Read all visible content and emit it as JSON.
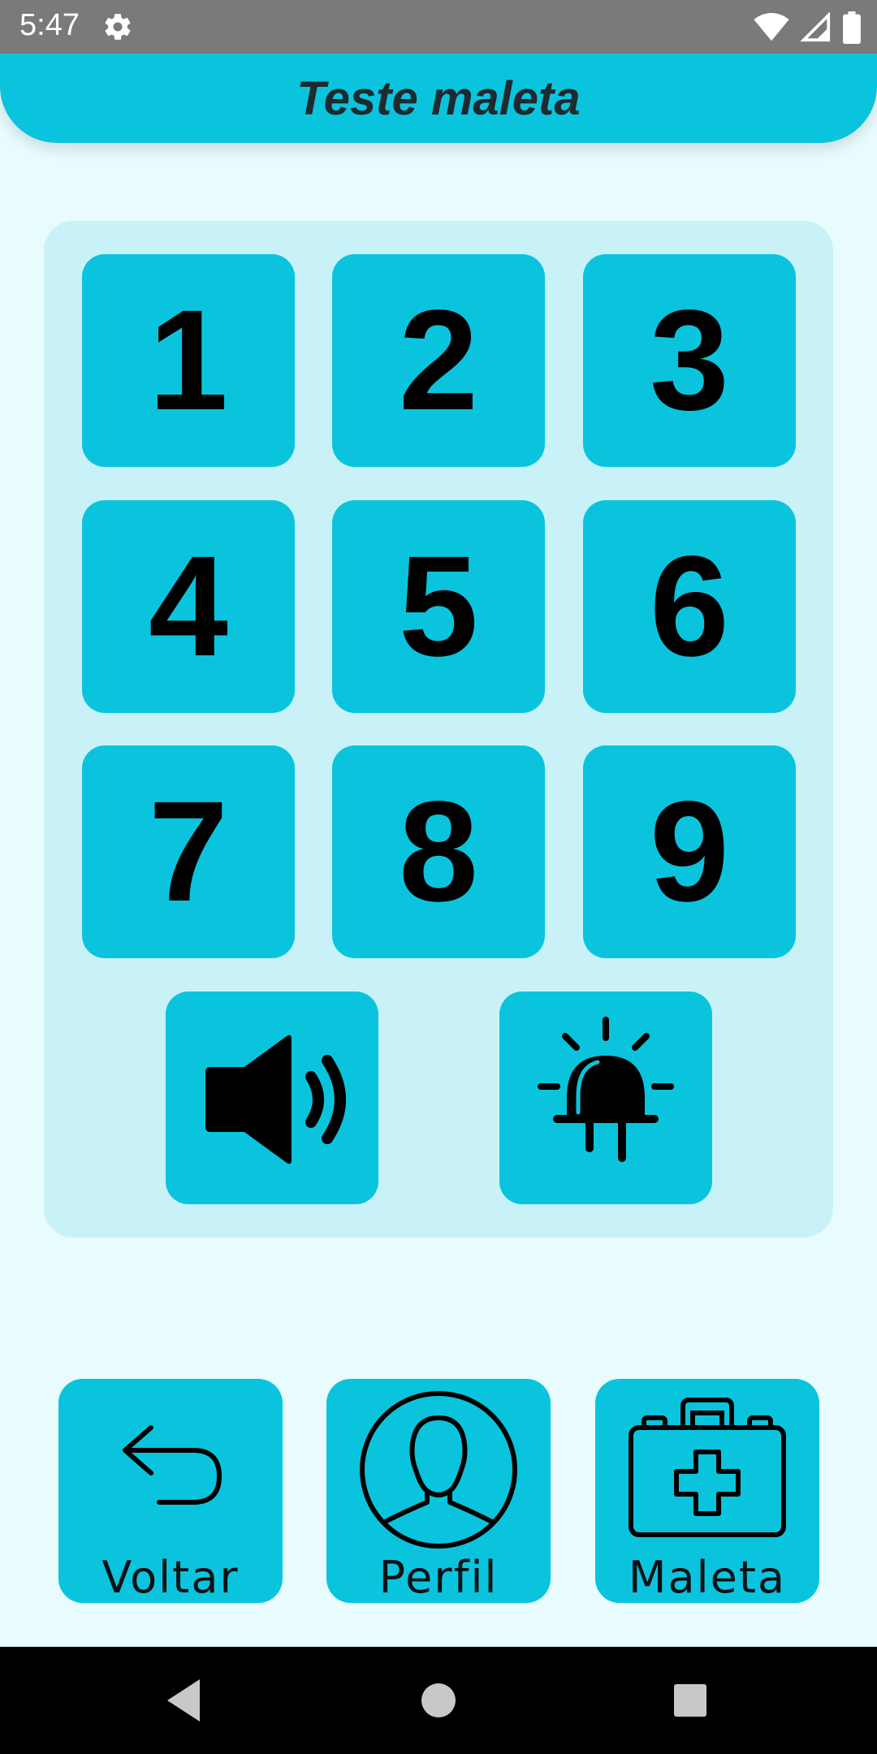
{
  "status_bar": {
    "time": "5:47",
    "icons": [
      "settings-icon",
      "wifi-icon",
      "cell-signal-icon",
      "battery-icon"
    ]
  },
  "header": {
    "title": "Teste maleta"
  },
  "keypad": {
    "keys": [
      "1",
      "2",
      "3",
      "4",
      "5",
      "6",
      "7",
      "8",
      "9"
    ],
    "icon_keys": [
      "speaker-icon",
      "siren-icon"
    ]
  },
  "bottom_nav": {
    "back_label": "Voltar",
    "profile_label": "Perfil",
    "kit_label": "Maleta"
  },
  "colors": {
    "accent": "#0ac4de",
    "panel": "#c9f2f8",
    "background": "#e8fcfd",
    "status_bar": "#7a7a7a"
  }
}
